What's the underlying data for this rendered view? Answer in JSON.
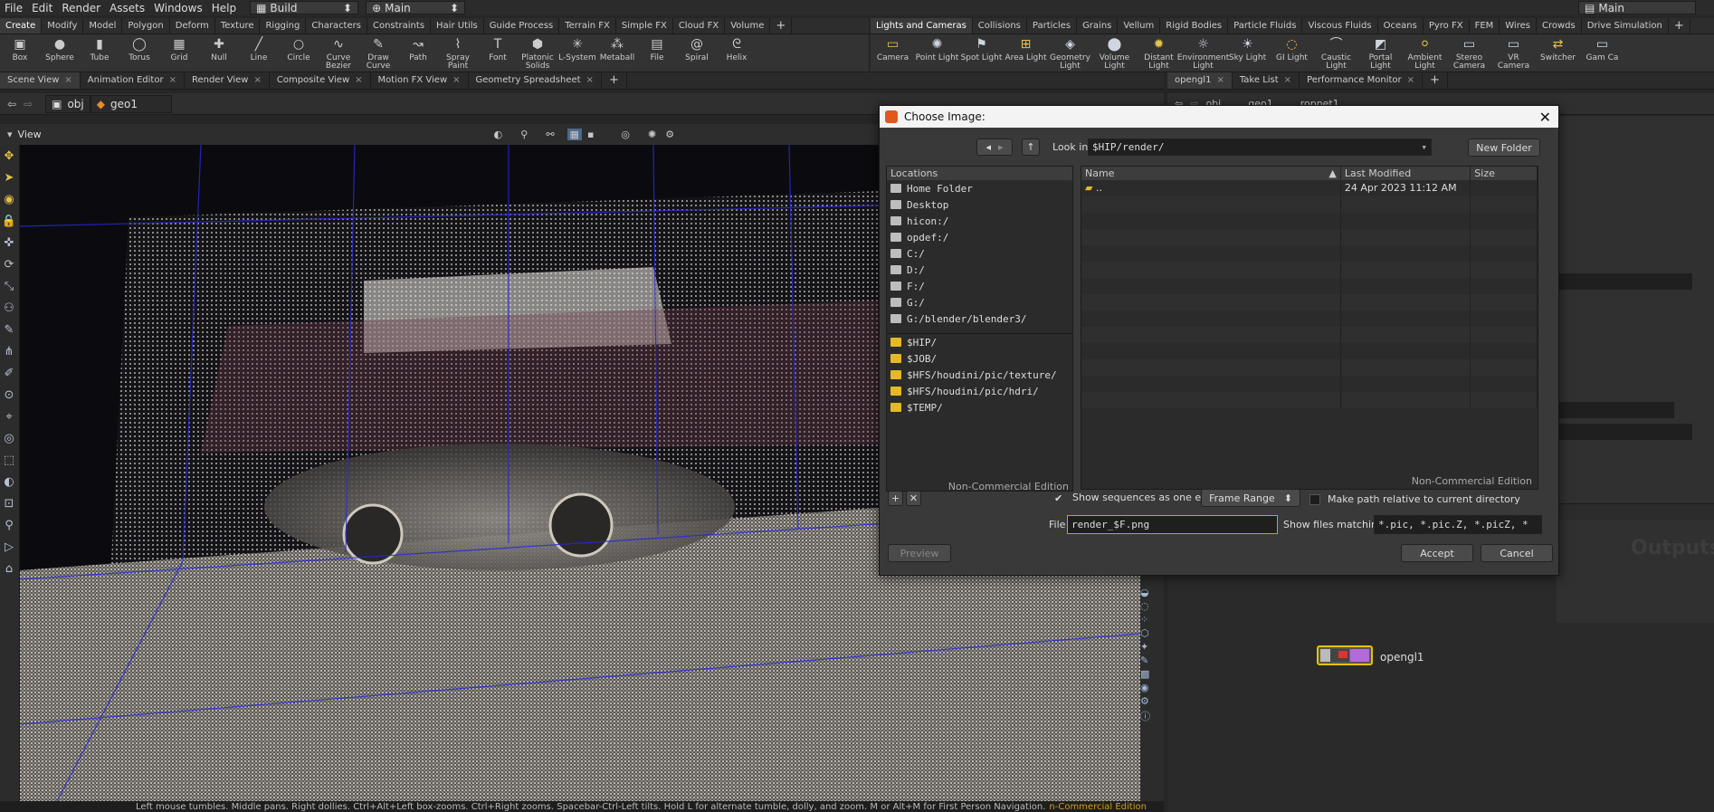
{
  "menubar": {
    "items": [
      "File",
      "Edit",
      "Render",
      "Assets",
      "Windows",
      "Help"
    ],
    "desktop_build": "Build",
    "desktop_main": "Main",
    "right_desktop": "Main"
  },
  "shelf_tabs_left": [
    "Create",
    "Modify",
    "Model",
    "Polygon",
    "Deform",
    "Texture",
    "Rigging",
    "Characters",
    "Constraints",
    "Hair Utils",
    "Guide Process",
    "Terrain FX",
    "Simple FX",
    "Cloud FX",
    "Volume"
  ],
  "shelf_tabs_right": [
    "Lights and Cameras",
    "Collisions",
    "Particles",
    "Grains",
    "Vellum",
    "Rigid Bodies",
    "Particle Fluids",
    "Viscous Fluids",
    "Oceans",
    "Pyro FX",
    "FEM",
    "Wires",
    "Crowds",
    "Drive Simulation"
  ],
  "tools_left": [
    {
      "label": "Box",
      "icon": "box-icon"
    },
    {
      "label": "Sphere",
      "icon": "sphere-icon"
    },
    {
      "label": "Tube",
      "icon": "tube-icon"
    },
    {
      "label": "Torus",
      "icon": "torus-icon"
    },
    {
      "label": "Grid",
      "icon": "grid-icon"
    },
    {
      "label": "Null",
      "icon": "null-icon"
    },
    {
      "label": "Line",
      "icon": "line-icon"
    },
    {
      "label": "Circle",
      "icon": "circle-icon"
    },
    {
      "label": "Curve Bezier",
      "icon": "curve-bezier-icon"
    },
    {
      "label": "Draw Curve",
      "icon": "draw-curve-icon"
    },
    {
      "label": "Path",
      "icon": "path-icon"
    },
    {
      "label": "Spray Paint",
      "icon": "spray-paint-icon"
    },
    {
      "label": "Font",
      "icon": "font-icon"
    },
    {
      "label": "Platonic Solids",
      "icon": "platonic-icon"
    },
    {
      "label": "L-System",
      "icon": "lsystem-icon"
    },
    {
      "label": "Metaball",
      "icon": "metaball-icon"
    },
    {
      "label": "File",
      "icon": "file-icon"
    },
    {
      "label": "Spiral",
      "icon": "spiral-icon"
    },
    {
      "label": "Helix",
      "icon": "helix-icon"
    }
  ],
  "tools_right": [
    {
      "label": "Camera"
    },
    {
      "label": "Point Light"
    },
    {
      "label": "Spot Light"
    },
    {
      "label": "Area Light"
    },
    {
      "label": "Geometry Light"
    },
    {
      "label": "Volume Light"
    },
    {
      "label": "Distant Light"
    },
    {
      "label": "Environment Light"
    },
    {
      "label": "Sky Light"
    },
    {
      "label": "GI Light"
    },
    {
      "label": "Caustic Light"
    },
    {
      "label": "Portal Light"
    },
    {
      "label": "Ambient Light"
    },
    {
      "label": "Stereo Camera"
    },
    {
      "label": "VR Camera"
    },
    {
      "label": "Switcher"
    },
    {
      "label": "Gam Ca"
    }
  ],
  "pane_tabs_left": [
    "Scene View",
    "Animation Editor",
    "Render View",
    "Composite View",
    "Motion FX View",
    "Geometry Spreadsheet"
  ],
  "pane_tabs_right": [
    "opengl1",
    "Take List",
    "Performance Monitor"
  ],
  "path": {
    "context": "obj",
    "node": "geo1",
    "right_path1": "obj",
    "right_path2": "geo1",
    "right_path3": "ropnet1"
  },
  "viewport": {
    "label": "View"
  },
  "status_text": "Left mouse tumbles. Middle pans. Right dollies. Ctrl+Alt+Left box-zooms. Ctrl+Right zooms. Spacebar-Ctrl-Left tilts. Hold L for alternate tumble, dolly, and zoom.    M or Alt+M for First Person Navigation.",
  "status_watermark": "n-Commercial Edition",
  "network": {
    "outputs_label": "Outputs",
    "node_label": "opengl1"
  },
  "dialog": {
    "title": "Choose Image:",
    "look_in_label": "Look in",
    "look_in_value": "$HIP/render/",
    "new_folder": "New Folder",
    "locations_header": "Locations",
    "locations": [
      "Home Folder",
      "Desktop",
      "hicon:/",
      "opdef:/",
      "C:/",
      "D:/",
      "F:/",
      "G:/",
      "G:/blender/blender3/"
    ],
    "bookmarks": [
      "$HIP/",
      "$JOB/",
      "$HFS/houdini/pic/texture/",
      "$HFS/houdini/pic/hdri/",
      "$TEMP/"
    ],
    "watermark": "Non-Commercial Edition",
    "col_name": "Name",
    "col_modified": "Last Modified",
    "col_size": "Size",
    "files": [
      {
        "name": "..",
        "modified": "24 Apr 2023 11:12 AM",
        "size": ""
      }
    ],
    "show_sequences": "Show sequences as one entry",
    "frame_range": "Frame Range",
    "relative_path": "Make path relative to current directory",
    "file_label": "File",
    "file_value": "render_$F.png",
    "matching_label": "Show files matching",
    "matching_value": "*.pic, *.pic.Z, *.picZ, *",
    "preview": "Preview",
    "accept": "Accept",
    "cancel": "Cancel"
  }
}
